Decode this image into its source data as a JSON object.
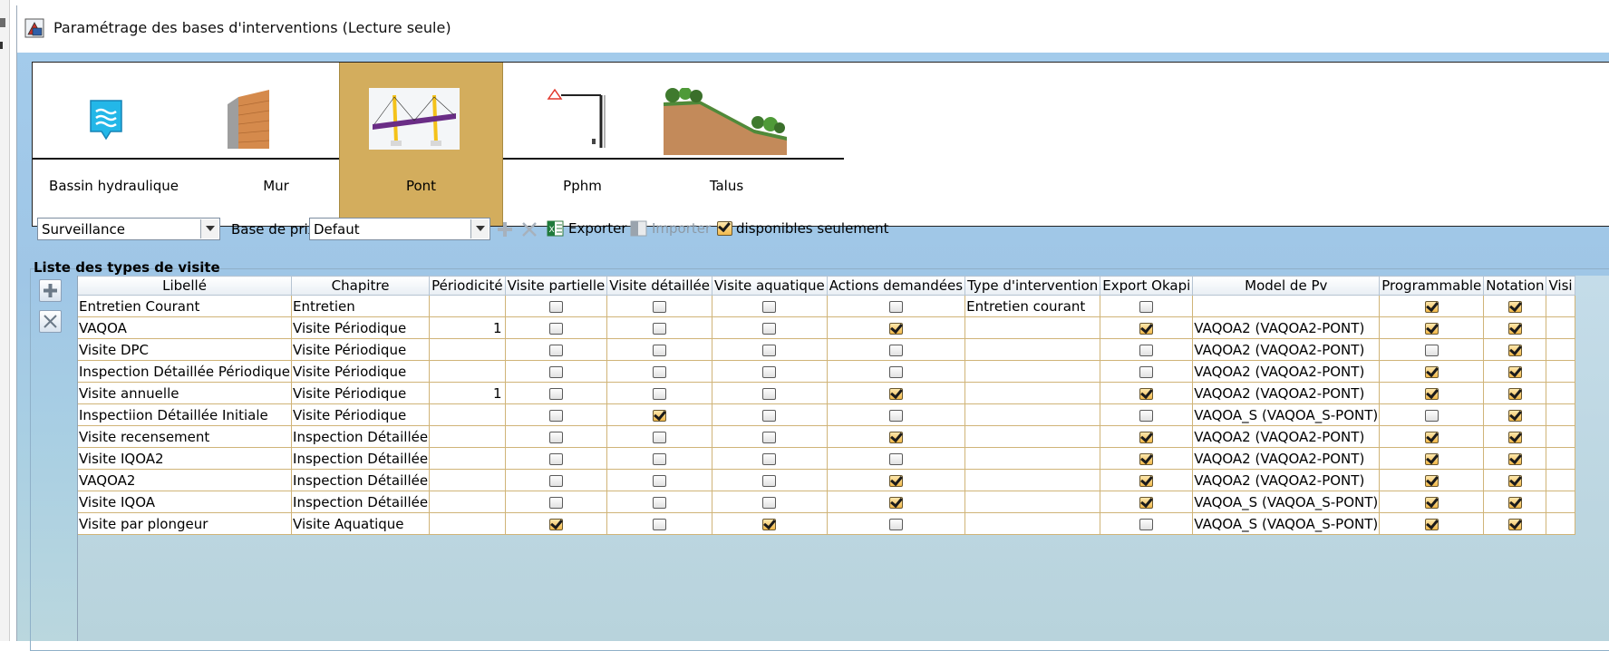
{
  "window": {
    "title": "Paramétrage des bases d'interventions (Lecture seule)"
  },
  "structure_types": [
    {
      "label": "Bassin hydraulique",
      "icon": "water-basin-icon",
      "selected": false
    },
    {
      "label": "Mur",
      "icon": "wall-icon",
      "selected": false
    },
    {
      "label": "Pont",
      "icon": "bridge-icon",
      "selected": true
    },
    {
      "label": "Pphm",
      "icon": "pole-icon",
      "selected": false
    },
    {
      "label": "Talus",
      "icon": "slope-icon",
      "selected": false
    }
  ],
  "toolbar": {
    "category_value": "Surveillance",
    "price_base_label": "Base de prix",
    "price_base_value": "Defaut",
    "export_label": "Exporter",
    "import_label": "Importer",
    "available_only_label": "disponibles seulement",
    "available_only_checked": true
  },
  "group": {
    "title": "Liste des types de visite"
  },
  "table": {
    "columns": [
      "Libellé",
      "Chapitre",
      "Périodicité",
      "Visite partielle",
      "Visite détaillée",
      "Visite aquatique",
      "Actions demandées",
      "Type d'intervention",
      "Export Okapi",
      "Model de Pv",
      "Programmable",
      "Notation",
      "Visi"
    ],
    "rows": [
      {
        "libelle": "Entretien Courant",
        "chapitre": "Entretien",
        "periodicite": "",
        "partielle": false,
        "detaillee": false,
        "aquatique": false,
        "actions": false,
        "type_intervention": "Entretien courant",
        "okapi": false,
        "model_pv": "",
        "programmable": true,
        "notation": true
      },
      {
        "libelle": "VAQOA",
        "chapitre": "Visite Périodique",
        "periodicite": "1",
        "partielle": false,
        "detaillee": false,
        "aquatique": false,
        "actions": true,
        "type_intervention": "",
        "okapi": true,
        "model_pv": "VAQOA2 (VAQOA2-PONT)",
        "programmable": true,
        "notation": true
      },
      {
        "libelle": "Visite DPC",
        "chapitre": "Visite Périodique",
        "periodicite": "",
        "partielle": false,
        "detaillee": false,
        "aquatique": false,
        "actions": false,
        "type_intervention": "",
        "okapi": false,
        "model_pv": "VAQOA2 (VAQOA2-PONT)",
        "programmable": false,
        "notation": true
      },
      {
        "libelle": "Inspection Détaillée Périodique",
        "chapitre": "Visite Périodique",
        "periodicite": "",
        "partielle": false,
        "detaillee": false,
        "aquatique": false,
        "actions": false,
        "type_intervention": "",
        "okapi": false,
        "model_pv": "VAQOA2 (VAQOA2-PONT)",
        "programmable": true,
        "notation": true
      },
      {
        "libelle": "Visite annuelle",
        "chapitre": "Visite Périodique",
        "periodicite": "1",
        "partielle": false,
        "detaillee": false,
        "aquatique": false,
        "actions": true,
        "type_intervention": "",
        "okapi": true,
        "model_pv": "VAQOA2 (VAQOA2-PONT)",
        "programmable": true,
        "notation": true
      },
      {
        "libelle": "Inspectiion Détaillée Initiale",
        "chapitre": "Visite Périodique",
        "periodicite": "",
        "partielle": false,
        "detaillee": true,
        "aquatique": false,
        "actions": false,
        "type_intervention": "",
        "okapi": false,
        "model_pv": "VAQOA_S (VAQOA_S-PONT)",
        "programmable": false,
        "notation": true
      },
      {
        "libelle": "Visite recensement",
        "chapitre": "Inspection Détaillée",
        "periodicite": "",
        "partielle": false,
        "detaillee": false,
        "aquatique": false,
        "actions": true,
        "type_intervention": "",
        "okapi": true,
        "model_pv": "VAQOA2 (VAQOA2-PONT)",
        "programmable": true,
        "notation": true
      },
      {
        "libelle": "Visite IQOA2",
        "chapitre": "Inspection Détaillée",
        "periodicite": "",
        "partielle": false,
        "detaillee": false,
        "aquatique": false,
        "actions": false,
        "type_intervention": "",
        "okapi": true,
        "model_pv": "VAQOA2 (VAQOA2-PONT)",
        "programmable": true,
        "notation": true
      },
      {
        "libelle": "VAQOA2",
        "chapitre": "Inspection Détaillée",
        "periodicite": "",
        "partielle": false,
        "detaillee": false,
        "aquatique": false,
        "actions": true,
        "type_intervention": "",
        "okapi": true,
        "model_pv": "VAQOA2 (VAQOA2-PONT)",
        "programmable": true,
        "notation": true
      },
      {
        "libelle": "Visite IQOA",
        "chapitre": "Inspection Détaillée",
        "periodicite": "",
        "partielle": false,
        "detaillee": false,
        "aquatique": false,
        "actions": true,
        "type_intervention": "",
        "okapi": true,
        "model_pv": "VAQOA_S (VAQOA_S-PONT)",
        "programmable": true,
        "notation": true
      },
      {
        "libelle": "Visite par plongeur",
        "chapitre": "Visite Aquatique",
        "periodicite": "",
        "partielle": true,
        "detaillee": false,
        "aquatique": true,
        "actions": false,
        "type_intervention": "",
        "okapi": false,
        "model_pv": "VAQOA_S (VAQOA_S-PONT)",
        "programmable": true,
        "notation": true
      }
    ]
  },
  "colors": {
    "selected_type_bg": "#d3ad5d",
    "window_bg": "#a4ccec",
    "checkbox_checked": "#f2b94b"
  }
}
